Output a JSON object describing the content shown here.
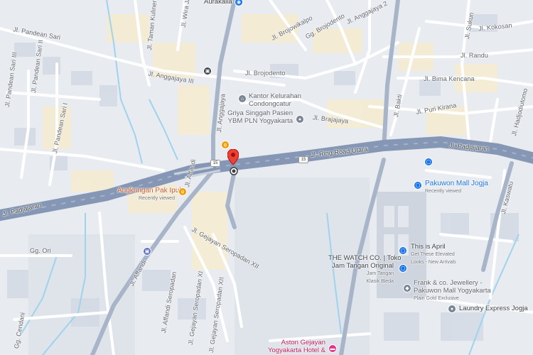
{
  "roads": {
    "padjajaran_west": "Jl. Padjajaran",
    "padjajaran_east": "Jl. Padjajaran",
    "ring_road_utara": "Jl. Ring Road Utara",
    "pandean_sari": "Jl. Pandean Sari",
    "pandean_sari_i": "Jl. Pandean Sari I",
    "pandean_sari_ii": "Jl. Pandean Sari II",
    "pandean_sari_iii": "Jl. Pandean Sari III",
    "taman_kuliner": "Jl. Taman Kuliner",
    "wira_jaya": "Jl. Wira Jaya",
    "anggajaya_iii": "Jl. Anggajaya III",
    "anggajaya": "Jl. Anggajaya",
    "anggajaya_2": "Jl. Anggajaya 2",
    "brojodento": "Jl. Brojodento",
    "brojowikalpo": "Jl. Brojowikalpo",
    "gg_brojodento": "Gg. Brojodento",
    "brajajaya": "Jl. Brajajaya",
    "bakti": "Jl. Bakti",
    "puri_kirana": "Jl. Puri Kirana",
    "bima_kencana": "Jl. Bima Kencana",
    "randu": "Jl. Randu",
    "kokosan": "Jl. Kokosan",
    "sukun": "Jl. Sukun",
    "hadjodiutomo": "Jl. Hadjodiutomo",
    "kaswatu": "Jl. Kaswatu",
    "affandi": "Jl. Affandi",
    "affandi_2": "Jl. Affandi",
    "gejayan_seropadan_xii": "Jl. Gejayan Seropadan XII",
    "gejayan_seropadan_xi": "Jl. Gejayan Seropadan XI",
    "affandi_seropadan": "Jl. Affandi Seropadan",
    "gg_ori": "Gg. Ori",
    "gg_cendani": "Gg. Cendani",
    "gejayan_seropadan_xii_b": "Jl. Gejayan Seropadan XII",
    "route_15": "15",
    "route_15b": "15"
  },
  "pois": {
    "aurakalla": "Aurakalla",
    "kantor_kelurahan_1": "Kantor Kelurahan",
    "kantor_kelurahan_2": "Condongcatur",
    "griya_1": "Griya Singgah Pasien",
    "griya_2": "YBM PLN Yogyakarta",
    "angkringan": "Angkringan Pak Ipul",
    "angkringan_sub": "Recently viewed",
    "pakuwon": "Pakuwon Mall Jogja",
    "pakuwon_sub": "Recently viewed",
    "this_is_april": "This is April",
    "this_is_april_sub1": "Get These Elevated",
    "this_is_april_sub2": "Looks - New Arrivals",
    "watch_co_1": "THE WATCH CO. | Toko",
    "watch_co_2": "Jam Tangan Original",
    "watch_co_sub1": "Jam Tangan",
    "watch_co_sub2": "Klasik Bleda",
    "frank_1": "Frank & co. Jewellery -",
    "frank_2": "Pakuwon Mall Yogyakarta",
    "frank_sub": "Plain Gold Exclusive",
    "laundry": "Laundry Express Jogja",
    "aston_1": "Aston Gejayan",
    "aston_2": "Yogyakarta Hotel &",
    "top_partial": "Jamus"
  },
  "colors": {
    "main_road": "#8a9bb5",
    "street": "#ffffff",
    "block": "#dde2ea",
    "building_beige": "#f6ebd0",
    "water": "#a6d8f0",
    "marker": "#ea4335"
  },
  "icons": {
    "marker": "red-location-pin-icon",
    "current": "current-location-dot-icon"
  }
}
